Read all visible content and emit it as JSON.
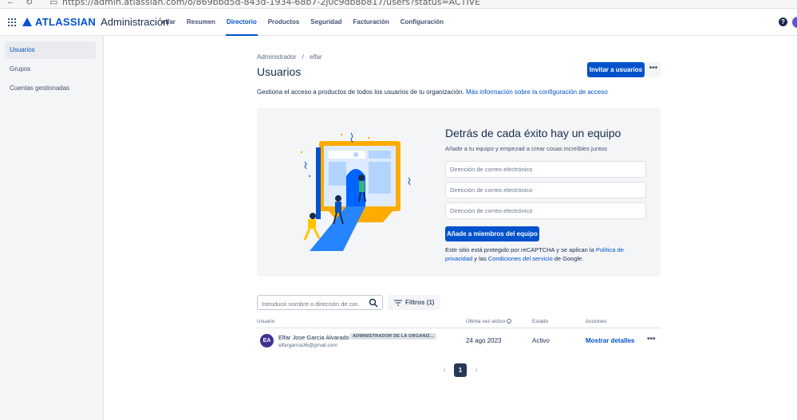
{
  "browser": {
    "url": "https://admin.atlassian.com/o/869bbd5d-843d-1934-68b7-2j0c9db8b817/users?status=ACTIVE"
  },
  "topnav": {
    "logo_text": "ATLASSIAN",
    "product": "Administración",
    "items": [
      {
        "label": "elfar",
        "active": false
      },
      {
        "label": "Resumen",
        "active": false
      },
      {
        "label": "Directorio",
        "active": true
      },
      {
        "label": "Productos",
        "active": false
      },
      {
        "label": "Seguridad",
        "active": false
      },
      {
        "label": "Facturación",
        "active": false
      },
      {
        "label": "Configuración",
        "active": false
      }
    ],
    "help_glyph": "?"
  },
  "sidebar": {
    "items": [
      {
        "label": "Usuarios",
        "active": true
      },
      {
        "label": "Grupos",
        "active": false
      },
      {
        "label": "Cuentas gestionadas",
        "active": false
      }
    ]
  },
  "main": {
    "breadcrumb": [
      "Administrador",
      "elfar"
    ],
    "breadcrumb_sep": "/",
    "title": "Usuarios",
    "invite_label": "Invitar a usuarios",
    "more_glyph": "•••",
    "description": "Gestiona el acceso a productos de todos los usuarios de tu organización.",
    "description_link": "Más información sobre la configuración de acceso"
  },
  "promo": {
    "title": "Detrás de cada éxito hay un equipo",
    "subtitle": "Añade a tu equipo y empezad a crear cosas increíbles juntos",
    "email_placeholder": "Dirección de correo electrónico",
    "add_button": "Añade a miembros del equipo",
    "recaptcha_pre": "Este sitio está protegido por reCAPTCHA y se aplican la ",
    "recaptcha_link1": "Política de privacidad",
    "recaptcha_mid": " y las ",
    "recaptcha_link2": "Condiciones del servicio",
    "recaptcha_post": " de Google."
  },
  "filters": {
    "search_placeholder": "Introducir nombre o dirección de cor...",
    "filter_label": "Filtros (1)"
  },
  "table": {
    "headers": {
      "user": "Usuario",
      "last_active": "Última vez activo",
      "status": "Estado",
      "actions": "Acciones"
    },
    "rows": [
      {
        "initials": "EA",
        "name": "Elfar Jose Garcia Alvarado",
        "badge": "ADMINISTRADOR DE LA ORGANIZ...",
        "email": "elfargarcia36@gmail.com",
        "last_active": "24 ago 2023",
        "status": "Activo",
        "action": "Mostrar detalles",
        "more": "•••"
      }
    ]
  },
  "pagination": {
    "current": "1",
    "prev": "‹",
    "next": "›"
  },
  "colors": {
    "brand": "#0052cc",
    "avatar": "#403294",
    "illustration_yellow": "#ffab00",
    "illustration_blue": "#0065ff"
  }
}
